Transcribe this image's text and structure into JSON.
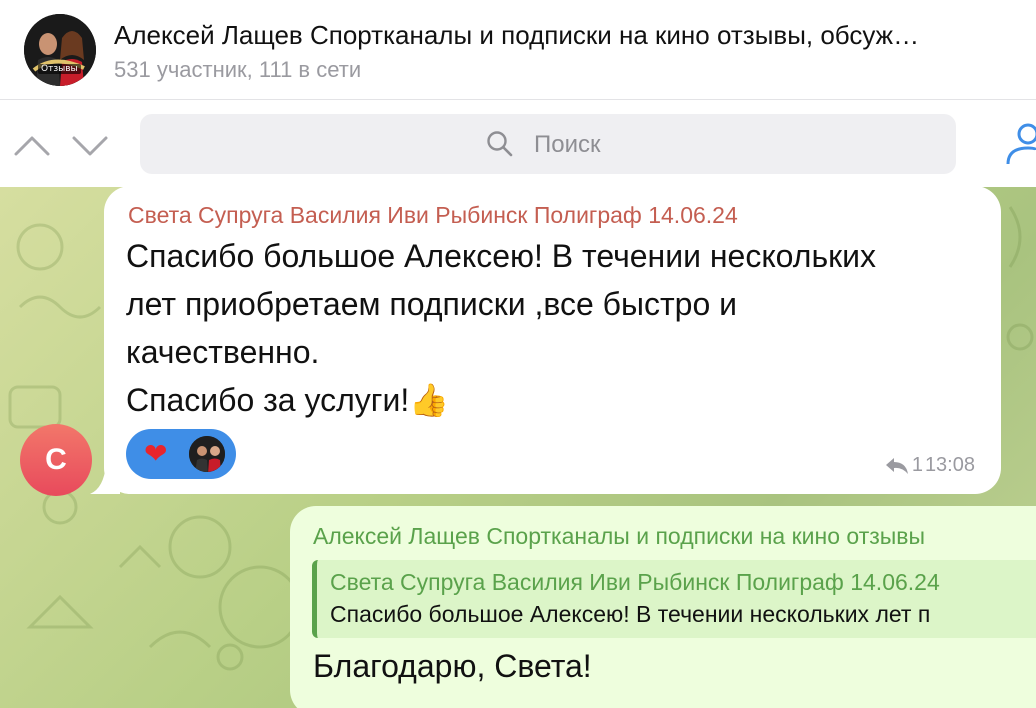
{
  "header": {
    "title": "Алексей Лащев Спортканалы и подписки на кино отзывы, обсуж…",
    "subtitle": "531 участник, 111 в сети",
    "avatar_badge": "Отзывы"
  },
  "search": {
    "placeholder": "Поиск"
  },
  "messages": {
    "incoming": {
      "sender": "Света Супруга Василия Иви Рыбинск Полиграф 14.06.24",
      "text_lines": [
        "Спасибо большое Алексею! В течении нескольких",
        "лет приобретаем подписки ,все быстро и",
        "качественно.",
        "Спасибо за услуги!👍"
      ],
      "reaction": "❤",
      "reply_count": "1",
      "time": "13:08",
      "avatar_letter": "С"
    },
    "outgoing": {
      "sender": "Алексей Лащев Спортканалы и подписки на кино отзывы",
      "quote_sender": "Света Супруга Василия Иви Рыбинск Полиграф 14.06.24",
      "quote_text": "Спасибо большое Алексею! В течении нескольких лет п",
      "text": "Благодарю, Света!"
    }
  },
  "colors": {
    "sender_in": "#c45e51",
    "sender_out": "#5aa24b",
    "reaction_bg": "#3f8ee7",
    "accent": "#3f8ee7"
  }
}
